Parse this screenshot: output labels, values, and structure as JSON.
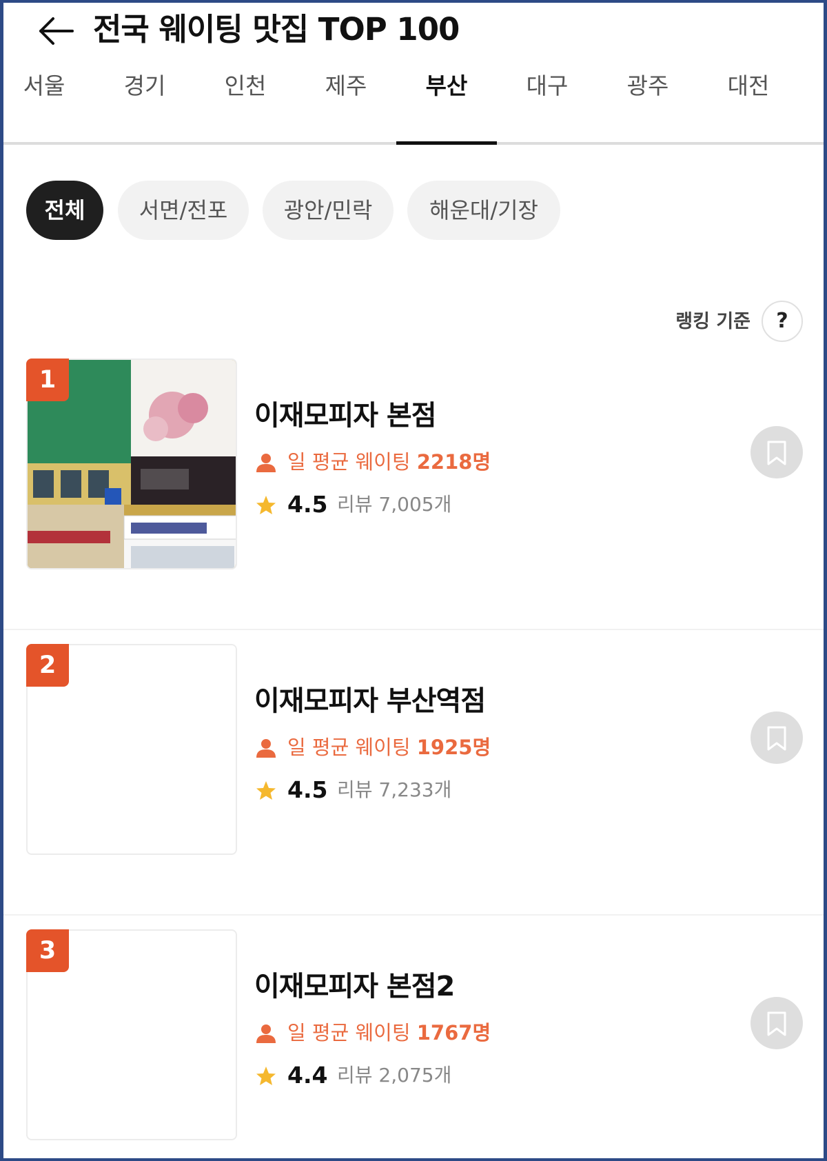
{
  "header": {
    "title": "전국 웨이팅 맛집 TOP 100",
    "back_icon": "arrow-left-icon"
  },
  "regions": [
    "서울",
    "경기",
    "인천",
    "제주",
    "부산",
    "대구",
    "광주",
    "대전"
  ],
  "active_region": "부산",
  "areas": [
    "전체",
    "서면/전포",
    "광안/민락",
    "해운대/기장"
  ],
  "active_area": "전체",
  "ranking_criteria": {
    "label": "랭킹 기준",
    "help": "?"
  },
  "accent_color": "#e4542a",
  "items": [
    {
      "rank": "1",
      "name": "이재모피자 본점",
      "waiting_label": "일 평균 웨이팅",
      "waiting_count": "2218명",
      "rating": "4.5",
      "reviews": "리뷰 7,005개",
      "has_photo": true
    },
    {
      "rank": "2",
      "name": "이재모피자 부산역점",
      "waiting_label": "일 평균 웨이팅",
      "waiting_count": "1925명",
      "rating": "4.5",
      "reviews": "리뷰 7,233개",
      "has_photo": false
    },
    {
      "rank": "3",
      "name": "이재모피자 본점2",
      "waiting_label": "일 평균 웨이팅",
      "waiting_count": "1767명",
      "rating": "4.4",
      "reviews": "리뷰 2,075개",
      "has_photo": false
    }
  ]
}
